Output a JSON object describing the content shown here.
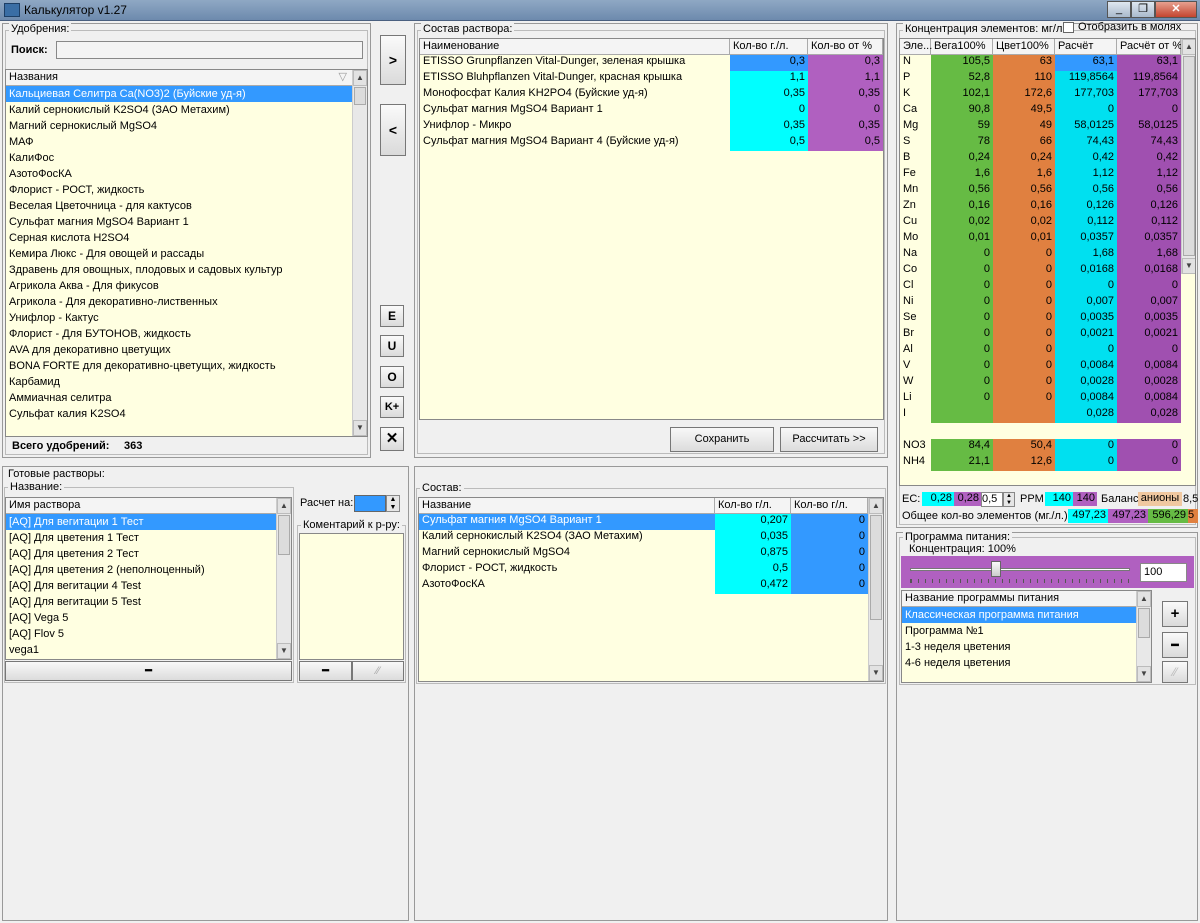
{
  "window": {
    "title": "Калькулятор v1.27"
  },
  "fertilizers": {
    "group_label": "Удобрения:",
    "search_label": "Поиск:",
    "search_value": "",
    "column_header": "Названия",
    "items": [
      "Кальциевая Селитра Ca(NO3)2 (Буйские уд-я)",
      "Калий  сернокислый  K2SO4 (ЗАО Метахим)",
      "Магний сернокислый MgSO4",
      "МАФ",
      "КалиФос",
      "АзотоФосКА",
      "Флорист - РОСТ, жидкость",
      "Веселая Цветочница - для кактусов",
      "Сульфат магния MgSO4 Вариант 1",
      "Серная кислота H2SO4",
      "Кемира Люкс - Для овощей и рассады",
      "Здравень для овощных, плодовых и садовых культур",
      "Агрикола Аква - Для фикусов",
      "Агрикола - Для декоративно-лиственных",
      "Унифлор - Кактус",
      "Флорист - Для БУТОНОВ, жидкость",
      "AVA для декоративно цветущих",
      "BONA FORTE для декоративно-цветущих, жидкость",
      "Карбамид",
      "Аммиачная селитра",
      "Сульфат калия K2SO4"
    ],
    "total_label": "Всего удобрений:",
    "total_value": "363"
  },
  "middle_buttons": {
    "add": ">",
    "remove": "<",
    "e": "E",
    "u": "U",
    "o": "O",
    "k": "K+",
    "x": "✕"
  },
  "composition": {
    "group_label": "Состав раствора:",
    "headers": [
      "Наименование",
      "Кол-во г./л.",
      "Кол-во от %"
    ],
    "rows": [
      {
        "name": "ETISSO Grunpflanzen Vital-Dunger, зеленая крышка",
        "g": "0,3",
        "pct": "0,3"
      },
      {
        "name": "ETISSO Bluhpflanzen Vital-Dunger, красная крышка",
        "g": "1,1",
        "pct": "1,1"
      },
      {
        "name": "Монофосфат Калия KH2PO4 (Буйские уд-я)",
        "g": "0,35",
        "pct": "0,35"
      },
      {
        "name": "Сульфат магния MgSO4 Вариант 1",
        "g": "0",
        "pct": "0"
      },
      {
        "name": "Унифлор - Микро",
        "g": "0,35",
        "pct": "0,35"
      },
      {
        "name": "Сульфат магния MgSO4 Вариант 4 (Буйские уд-я)",
        "g": "0,5",
        "pct": "0,5"
      }
    ],
    "save_label": "Сохранить",
    "calc_label": "Рассчитать >>"
  },
  "concentration": {
    "group_label": "Концентрация элементов: мг/л.",
    "moles_label": "Отобразить в молях",
    "headers": [
      "Эле...",
      "Вега100%",
      "Цвет100%",
      "Расчёт",
      "Расчёт от %"
    ],
    "rows": [
      {
        "el": "N",
        "a": "105,5",
        "b": "63",
        "c": "63,1",
        "d": "63,1"
      },
      {
        "el": "P",
        "a": "52,8",
        "b": "110",
        "c": "119,8564",
        "d": "119,8564"
      },
      {
        "el": "K",
        "a": "102,1",
        "b": "172,6",
        "c": "177,703",
        "d": "177,703"
      },
      {
        "el": "Ca",
        "a": "90,8",
        "b": "49,5",
        "c": "0",
        "d": "0"
      },
      {
        "el": "Mg",
        "a": "59",
        "b": "49",
        "c": "58,0125",
        "d": "58,0125"
      },
      {
        "el": "S",
        "a": "78",
        "b": "66",
        "c": "74,43",
        "d": "74,43"
      },
      {
        "el": "B",
        "a": "0,24",
        "b": "0,24",
        "c": "0,42",
        "d": "0,42"
      },
      {
        "el": "Fe",
        "a": "1,6",
        "b": "1,6",
        "c": "1,12",
        "d": "1,12"
      },
      {
        "el": "Mn",
        "a": "0,56",
        "b": "0,56",
        "c": "0,56",
        "d": "0,56"
      },
      {
        "el": "Zn",
        "a": "0,16",
        "b": "0,16",
        "c": "0,126",
        "d": "0,126"
      },
      {
        "el": "Cu",
        "a": "0,02",
        "b": "0,02",
        "c": "0,112",
        "d": "0,112"
      },
      {
        "el": "Mo",
        "a": "0,01",
        "b": "0,01",
        "c": "0,0357",
        "d": "0,0357"
      },
      {
        "el": "Na",
        "a": "0",
        "b": "0",
        "c": "1,68",
        "d": "1,68"
      },
      {
        "el": "Co",
        "a": "0",
        "b": "0",
        "c": "0,0168",
        "d": "0,0168"
      },
      {
        "el": "Cl",
        "a": "0",
        "b": "0",
        "c": "0",
        "d": "0"
      },
      {
        "el": "Ni",
        "a": "0",
        "b": "0",
        "c": "0,007",
        "d": "0,007"
      },
      {
        "el": "Se",
        "a": "0",
        "b": "0",
        "c": "0,0035",
        "d": "0,0035"
      },
      {
        "el": "Br",
        "a": "0",
        "b": "0",
        "c": "0,0021",
        "d": "0,0021"
      },
      {
        "el": "Al",
        "a": "0",
        "b": "0",
        "c": "0",
        "d": "0"
      },
      {
        "el": "V",
        "a": "0",
        "b": "0",
        "c": "0,0084",
        "d": "0,0084"
      },
      {
        "el": "W",
        "a": "0",
        "b": "0",
        "c": "0,0028",
        "d": "0,0028"
      },
      {
        "el": "Li",
        "a": "0",
        "b": "0",
        "c": "0,0084",
        "d": "0,0084"
      },
      {
        "el": "I",
        "a": "",
        "b": "",
        "c": "0,028",
        "d": "0,028"
      },
      {
        "el": "",
        "a": "",
        "b": "",
        "c": "",
        "d": ""
      },
      {
        "el": "NO3",
        "a": "84,4",
        "b": "50,4",
        "c": "0",
        "d": "0"
      },
      {
        "el": "NH4",
        "a": "21,1",
        "b": "12,6",
        "c": "0",
        "d": "0"
      }
    ],
    "ec_label": "EC:",
    "ec1": "0,28",
    "ec2": "0,28",
    "ec_step": "0,5",
    "ppm_label": "PPM",
    "ppm1": "140",
    "ppm2": "140",
    "balance_label": "Баланс:",
    "anions_label": "анионы",
    "anions_value": "8,5",
    "total_label": "Общее кол-во элементов (мг./л.):",
    "tot1": "497,23",
    "tot2": "497,23",
    "tot3": "596,29",
    "tot4": "5"
  },
  "ready_solutions": {
    "group_label": "Готовые растворы:",
    "name_label": "Название:",
    "column_header": "Имя раствора",
    "items": [
      "[AQ] Для вегитации 1 Тест",
      "[AQ] Для цветения 1 Тест",
      "[AQ] Для цветения 2 Тест",
      "[AQ] Для цветения 2 (неполноценный)",
      "[AQ] Для вегитации 4 Test",
      "[AQ] Для вегитации 5 Test",
      "[AQ] Vega 5",
      "[AQ] Flov 5",
      "vega1"
    ],
    "calc_on_label": "Расчет на:",
    "comment_label": "Коментарий к р-ру:",
    "minus": "━"
  },
  "sostav": {
    "group_label": "Состав:",
    "headers": [
      "Название",
      "Кол-во г/л.",
      "Кол-во г/л."
    ],
    "rows": [
      {
        "name": "Сульфат магния MgSO4 Вариант 1",
        "a": "0,207",
        "b": "0"
      },
      {
        "name": "Калий  сернокислый  K2SO4 (ЗАО Метахим)",
        "a": "0,035",
        "b": "0"
      },
      {
        "name": "Магний сернокислый MgSO4",
        "a": "0,875",
        "b": "0"
      },
      {
        "name": "Флорист - РОСТ, жидкость",
        "a": "0,5",
        "b": "0"
      },
      {
        "name": "АзотоФосКА",
        "a": "0,472",
        "b": "0"
      }
    ]
  },
  "program": {
    "group_label": "Программа питания:",
    "conc_label": "Концентрация: 100%",
    "slider_value": "100",
    "slider_level_pct": 39,
    "column_header": "Название программы питания",
    "items": [
      "Классическая программа питания",
      "Программа №1",
      "1-3 неделя цветения",
      "4-6 неделя цветения"
    ],
    "plus": "+",
    "minus": "━"
  }
}
